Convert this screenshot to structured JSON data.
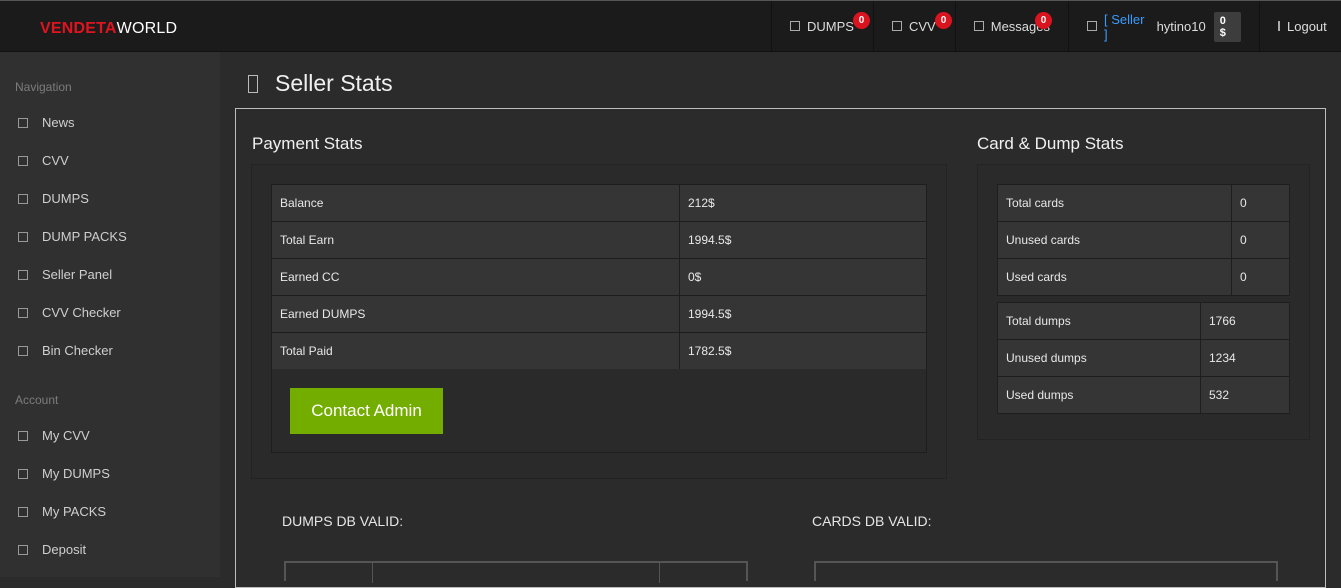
{
  "brand": {
    "part1": "VENDETA",
    "part2": "WORLD"
  },
  "topnav": {
    "dumps": {
      "label": "DUMPS",
      "badge": "0"
    },
    "cvv": {
      "label": "CVV",
      "badge": "0"
    },
    "messages": {
      "label": "Messages",
      "badge": "0"
    },
    "user": {
      "role": "[ Seller ]",
      "name": "hytino10",
      "balance": "0 $"
    },
    "logout": "Logout"
  },
  "sidebar": {
    "nav_heading": "Navigation",
    "nav_items": [
      "News",
      "CVV",
      "DUMPS",
      "DUMP PACKS",
      "Seller Panel",
      "CVV Checker",
      "Bin Checker"
    ],
    "account_heading": "Account",
    "account_items": [
      "My CVV",
      "My DUMPS",
      "My PACKS",
      "Deposit"
    ]
  },
  "page": {
    "title": "Seller Stats"
  },
  "payment": {
    "title": "Payment Stats",
    "rows": [
      {
        "label": "Balance",
        "value": "212$"
      },
      {
        "label": "Total Earn",
        "value": "1994.5$"
      },
      {
        "label": "Earned CC",
        "value": "0$"
      },
      {
        "label": "Earned DUMPS",
        "value": "1994.5$"
      },
      {
        "label": "Total Paid",
        "value": "1782.5$"
      }
    ],
    "button": "Contact Admin"
  },
  "card_dump": {
    "title": "Card & Dump Stats",
    "cards": [
      {
        "label": "Total cards",
        "value": "0"
      },
      {
        "label": "Unused cards",
        "value": "0"
      },
      {
        "label": "Used cards",
        "value": "0"
      }
    ],
    "dumps": [
      {
        "label": "Total dumps",
        "value": "1766"
      },
      {
        "label": "Unused dumps",
        "value": "1234"
      },
      {
        "label": "Used dumps",
        "value": "532"
      }
    ]
  },
  "db_valid": {
    "dumps": "DUMPS DB VALID:",
    "cards": "CARDS DB VALID:"
  },
  "colors": {
    "accent_green": "#72ad00",
    "brand_red": "#e0141f",
    "badge_red": "#d9141f",
    "seller_blue": "#3a9bff"
  }
}
